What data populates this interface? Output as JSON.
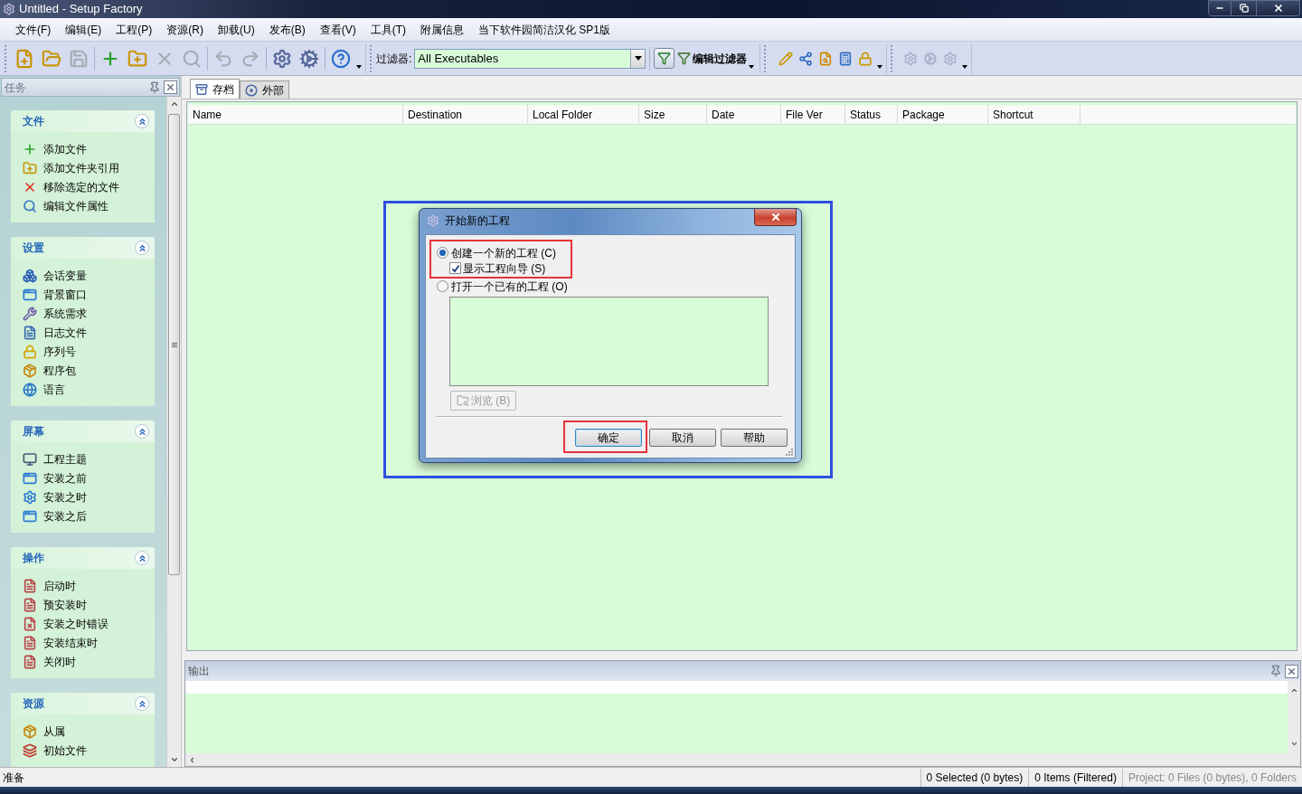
{
  "window": {
    "title": "Untitled - Setup Factory"
  },
  "menu": [
    "文件(F)",
    "编辑(E)",
    "工程(P)",
    "资源(R)",
    "卸载(U)",
    "发布(B)",
    "查看(V)",
    "工具(T)",
    "附属信息",
    "当下软件园简洁汉化 SP1版"
  ],
  "toolbar": {
    "main_buttons": [
      {
        "disabled": false
      },
      {
        "disabled": false
      },
      {
        "disabled": true
      },
      {
        "disabled": false
      },
      {
        "disabled": false
      },
      {
        "disabled": true
      },
      {
        "disabled": true
      },
      {
        "disabled": true
      },
      {
        "disabled": true
      },
      {
        "disabled": false
      },
      {
        "disabled": false
      },
      {
        "disabled": false
      }
    ],
    "filter_label": "过滤器:",
    "filter_value": "All Executables",
    "edit_filter_label": "编辑过滤器",
    "extra_buttons": [
      {
        "disabled": false
      },
      {
        "disabled": false
      },
      {
        "disabled": false
      },
      {
        "disabled": false
      },
      {
        "disabled": false
      }
    ],
    "build_buttons": [
      {
        "disabled": true
      },
      {
        "disabled": true
      },
      {
        "disabled": true
      }
    ]
  },
  "task_pane": {
    "title": "任务",
    "groups": [
      {
        "title": "文件",
        "expanded": true,
        "items": [
          "添加文件",
          "添加文件夹引用",
          "移除选定的文件",
          "编辑文件属性"
        ]
      },
      {
        "title": "设置",
        "expanded": true,
        "items": [
          "会话变量",
          "背景窗口",
          "系统需求",
          "日志文件",
          "序列号",
          "程序包",
          "语言"
        ]
      },
      {
        "title": "屏幕",
        "expanded": true,
        "items": [
          "工程主题",
          "安装之前",
          "安装之时",
          "安装之后"
        ]
      },
      {
        "title": "操作",
        "expanded": true,
        "items": [
          "启动时",
          "预安装时",
          "安装之时错误",
          "安装结束时",
          "关闭时"
        ]
      },
      {
        "title": "资源",
        "expanded": true,
        "items": [
          "从属",
          "初始文件"
        ]
      }
    ]
  },
  "tabs": [
    {
      "label": "存档",
      "selected": true
    },
    {
      "label": "外部",
      "selected": false
    }
  ],
  "table": {
    "columns": [
      "Name",
      "Destination",
      "Local Folder",
      "Size",
      "Date",
      "File Ver",
      "Status",
      "Package",
      "Shortcut"
    ]
  },
  "output": {
    "title": "输出"
  },
  "dialog": {
    "title": "开始新的工程",
    "highlighted": true,
    "create_group": {
      "highlighted": true,
      "radio": {
        "label": "创建一个新的工程 (C)",
        "selected": true
      },
      "wizard_checkbox": {
        "label": "显示工程向导 (S)",
        "checked": true
      }
    },
    "open_radio": {
      "label": "打开一个已有的工程 (O)",
      "selected": false
    },
    "browse_button": {
      "label": "浏览 (B)",
      "disabled": true
    },
    "buttons": [
      {
        "label": "确定",
        "focused": true,
        "highlighted": true
      },
      {
        "label": "取消",
        "focused": false,
        "highlighted": false
      },
      {
        "label": "帮助",
        "focused": false,
        "highlighted": false
      }
    ]
  },
  "status_bar": {
    "message": "准备",
    "panes": [
      {
        "text": "0 Selected (0 bytes)",
        "disabled": false
      },
      {
        "text": "0 Items (Filtered)",
        "disabled": false
      },
      {
        "text": "Project: 0 Files (0 bytes), 0 Folders",
        "disabled": true
      }
    ]
  }
}
